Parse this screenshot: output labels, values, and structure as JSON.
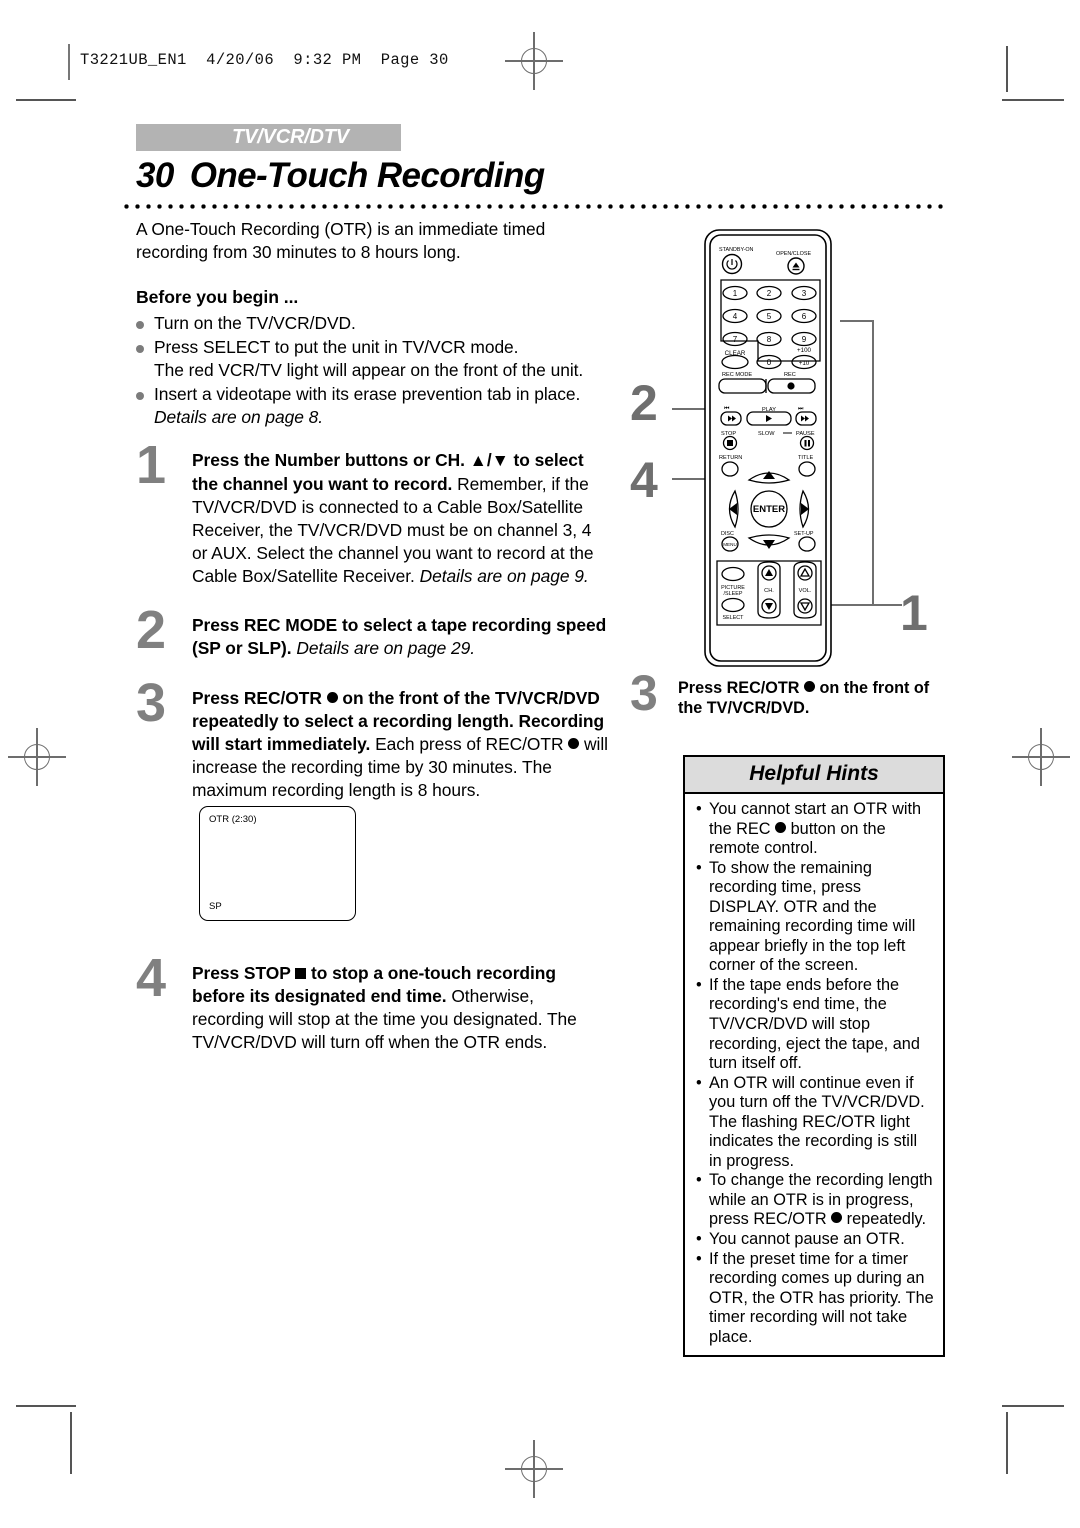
{
  "slug": "T3221UB_EN1  4/20/06  9:32 PM  Page 30",
  "header": {
    "tab_label": "TV/VCR/DTV",
    "page_number": "30",
    "title": "One-Touch Recording"
  },
  "intro": "A One-Touch Recording (OTR) is an immediate timed recording from 30 minutes to 8 hours long.",
  "before_you_begin": {
    "heading": "Before you begin ...",
    "items": [
      {
        "text": "Turn on the TV/VCR/DVD."
      },
      {
        "text": "Press SELECT to put the unit in TV/VCR mode.",
        "sub": "The red VCR/TV light will appear on the front of the unit."
      },
      {
        "text": "Insert a videotape with its erase prevention tab in place.",
        "sub_italic": "Details are on page 8."
      }
    ]
  },
  "steps": [
    {
      "number": "1",
      "bold": "Press the Number buttons or CH. ▲/▼ to select the channel you want to record.",
      "body1": "Remember, if the TV/VCR/DVD is connected to a Cable Box/Satellite Receiver, the TV/VCR/DVD must be on channel 3, 4 or AUX.",
      "body2": "Select the channel you want to record at the Cable Box/Satellite Receiver.",
      "body2_italic": "Details are on page 9."
    },
    {
      "number": "2",
      "bold": "Press REC MODE to select a tape recording speed (SP or SLP).",
      "body1_italic": "Details are on page 29."
    },
    {
      "number": "3",
      "bold_pre": "Press REC/OTR ",
      "bold_post": " on the front of the TV/VCR/DVD repeatedly to select a recording length. Recording will start immediately.",
      "body_pre": "Each press of REC/OTR ",
      "body_post": " will increase the recording time by 30 minutes. The maximum recording length is 8 hours."
    },
    {
      "number": "4",
      "bold_pre": "Press STOP ",
      "bold_post": " to stop a one-touch recording before its designated end time.",
      "body1": "Otherwise, recording will stop at the time you designated. The TV/VCR/DVD will turn off when the OTR ends."
    }
  ],
  "osd_screen": {
    "top_left_text": "OTR (2:30)",
    "bottom_left_text": "SP"
  },
  "right_step": {
    "number": "3",
    "line1_pre": "Press REC/OTR ",
    "line1_post": " on the",
    "line2": "front of the TV/VCR/DVD."
  },
  "hints": {
    "title": "Helpful Hints",
    "items": [
      {
        "pre": "You cannot start an OTR with the REC ",
        "post": " button on the remote control."
      },
      {
        "pre": "To show the remaining recording time, press DISPLAY. OTR and the remaining recording time will appear briefly in the top left corner of the screen.",
        "post": ""
      },
      {
        "pre": "If the tape ends before the recording's end time, the TV/VCR/DVD will stop recording, eject the tape, and turn itself off.",
        "post": ""
      },
      {
        "pre": "An OTR will continue even if you turn off the TV/VCR/DVD. The flashing REC/OTR light indicates the recording is still in progress.",
        "post": ""
      },
      {
        "pre": "To change the recording length while an OTR is in progress, press  REC/OTR ",
        "post": " repeatedly."
      },
      {
        "pre": "You cannot pause an OTR.",
        "post": ""
      },
      {
        "pre": "If the preset time for a timer recording comes up during an OTR, the OTR has priority. The timer recording will not take place.",
        "post": ""
      }
    ]
  },
  "callouts": [
    {
      "number": "2",
      "target": "rec-mode-button"
    },
    {
      "number": "4",
      "target": "stop-button"
    },
    {
      "number": "1",
      "target": "number-buttons-and-ch-buttons"
    }
  ],
  "remote": {
    "labels": {
      "standby_on": "STANDBY-ON",
      "open_close": "OPEN/CLOSE",
      "clear": "CLEAR",
      "plus100": "+100",
      "plus10": "+10",
      "rec_mode": "REC MODE",
      "rec": "REC",
      "play": "PLAY",
      "stop": "STOP",
      "slow": "SLOW",
      "pause": "PAUSE",
      "return": "RETURN",
      "title": "TITLE",
      "enter": "ENTER",
      "disc_menu": "DISC",
      "disc_menu2": "MENU",
      "setup": "SET-UP",
      "picture": "PICTURE",
      "sleep": "/SLEEP",
      "select": "SELECT",
      "ch": "CH.",
      "vol": "VOL."
    },
    "number_keys": [
      "1",
      "2",
      "3",
      "4",
      "5",
      "6",
      "7",
      "8",
      "9",
      "0"
    ]
  },
  "colors": {
    "tab_band": "#b3b3b3",
    "step_number": "#808080",
    "hints_header": "#dcdcdc",
    "bullet": "#7c7c7c"
  }
}
